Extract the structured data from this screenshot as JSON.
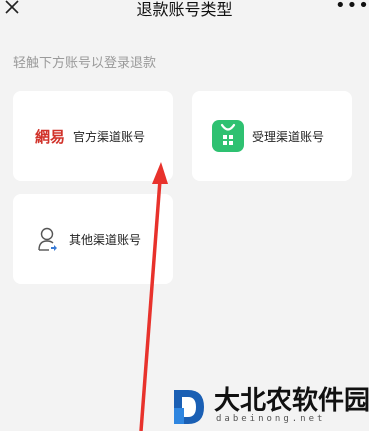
{
  "header": {
    "title": "退款账号类型",
    "more_label": "•••"
  },
  "hint": "轻触下方账号以登录退款",
  "accounts": [
    {
      "logo_text": "網易",
      "label": "官方渠道账号",
      "icon": "netease-logo"
    },
    {
      "label": "受理渠道账号",
      "icon": "green-app-icon"
    },
    {
      "label": "其他渠道账号",
      "icon": "person-icon"
    }
  ],
  "watermark": {
    "name": "大北农软件园",
    "url": "dabeinong.net"
  },
  "colors": {
    "background": "#f3f3f3",
    "card": "#ffffff",
    "netease_red": "#d1322a",
    "green_icon": "#2ec171",
    "arrow_red": "#e8322c"
  }
}
